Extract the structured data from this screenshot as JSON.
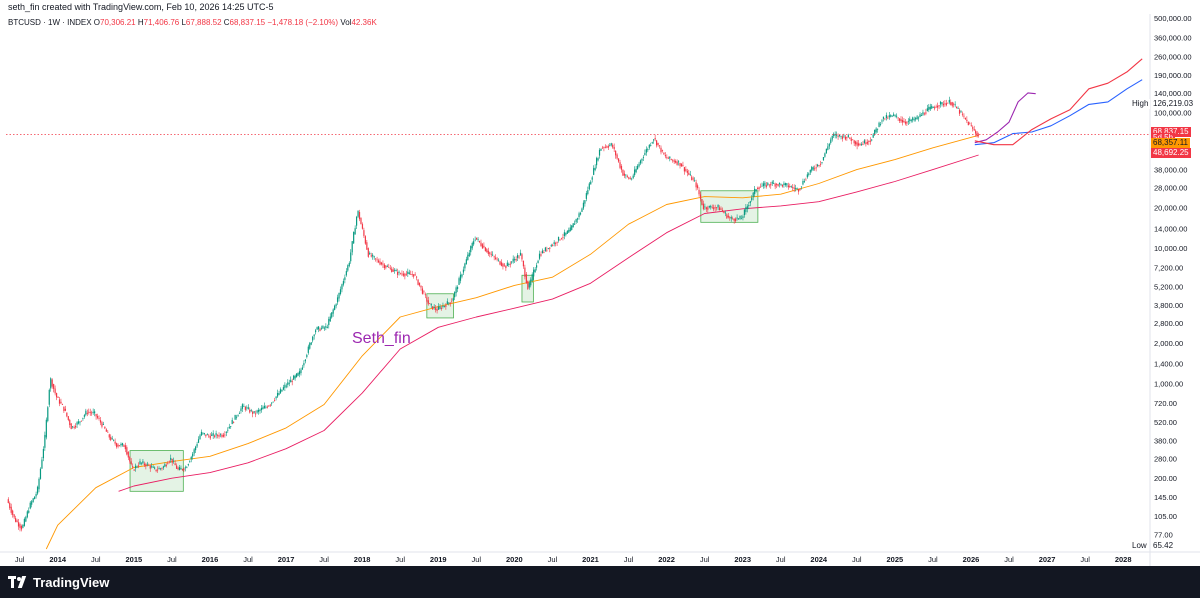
{
  "header": {
    "caption": "seth_fin created with TradingView.com, Feb 10, 2026 14:25 UTC-5"
  },
  "legend": {
    "symbol": "BTCUSD · 1W · INDEX",
    "open_label": "O",
    "open": "70,306.21",
    "high_label": "H",
    "high": "71,406.76",
    "low_label": "L",
    "low": "67,888.52",
    "close_label": "C",
    "close": "68,837.15",
    "change": "−1,478.18 (−2.10%)",
    "vol_label": "Vol",
    "vol": "42.36K"
  },
  "watermark": "Seth_fin",
  "footer": {
    "brand": "TradingView"
  },
  "colors": {
    "up": "#089981",
    "down": "#f23645",
    "ma_orange": "#ff9800",
    "ma_red": "#e91e63",
    "projection_purple": "#9c27b0",
    "projection_blue": "#2962ff",
    "projection_pink": "#f23645",
    "box_fill": "#4caf50",
    "watermark": "#9c27b0"
  },
  "chart_data": {
    "type": "line",
    "symbol": "BTCUSD",
    "interval": "1W",
    "y_scale": "log",
    "ylim": [
      60,
      500000
    ],
    "xlim": [
      "2013-06",
      "2028-04"
    ],
    "grid": false,
    "y_ticks": [
      "500,000.00",
      "360,000.00",
      "260,000.00",
      "190,000.00",
      "140,000.00",
      "100,000.00",
      "68,837.15",
      "50,000.00",
      "38,000.00",
      "28,000.00",
      "20,000.00",
      "14,000.00",
      "10,000.00",
      "7,200.00",
      "5,200.00",
      "3,800.00",
      "2,800.00",
      "2,000.00",
      "1,400.00",
      "1,000.00",
      "720.00",
      "520.00",
      "380.00",
      "280.00",
      "200.00",
      "145.00",
      "105.00",
      "77.00",
      "65.42"
    ],
    "y_tick_values": [
      500000,
      360000,
      260000,
      190000,
      140000,
      100000,
      68837,
      50000,
      38000,
      28000,
      20000,
      14000,
      10000,
      7200,
      5200,
      3800,
      2800,
      2000,
      1400,
      1000,
      720,
      520,
      380,
      280,
      200,
      145,
      105,
      77
    ],
    "x_ticks": [
      {
        "label": "Jul",
        "t": 2013.5
      },
      {
        "label": "2014",
        "t": 2014.0
      },
      {
        "label": "Jul",
        "t": 2014.5
      },
      {
        "label": "2015",
        "t": 2015.0
      },
      {
        "label": "Jul",
        "t": 2015.5
      },
      {
        "label": "2016",
        "t": 2016.0
      },
      {
        "label": "Jul",
        "t": 2016.5
      },
      {
        "label": "2017",
        "t": 2017.0
      },
      {
        "label": "Jul",
        "t": 2017.5
      },
      {
        "label": "2018",
        "t": 2018.0
      },
      {
        "label": "Jul",
        "t": 2018.5
      },
      {
        "label": "2019",
        "t": 2019.0
      },
      {
        "label": "Jul",
        "t": 2019.5
      },
      {
        "label": "2020",
        "t": 2020.0
      },
      {
        "label": "Jul",
        "t": 2020.5
      },
      {
        "label": "2021",
        "t": 2021.0
      },
      {
        "label": "Jul",
        "t": 2021.5
      },
      {
        "label": "2022",
        "t": 2022.0
      },
      {
        "label": "Jul",
        "t": 2022.5
      },
      {
        "label": "2023",
        "t": 2023.0
      },
      {
        "label": "Jul",
        "t": 2023.5
      },
      {
        "label": "2024",
        "t": 2024.0
      },
      {
        "label": "Jul",
        "t": 2024.5
      },
      {
        "label": "2025",
        "t": 2025.0
      },
      {
        "label": "Jul",
        "t": 2025.5
      },
      {
        "label": "2026",
        "t": 2026.0
      },
      {
        "label": "Jul",
        "t": 2026.5
      },
      {
        "label": "2027",
        "t": 2027.0
      },
      {
        "label": "Jul",
        "t": 2027.5
      },
      {
        "label": "2028",
        "t": 2028.0
      }
    ],
    "price_path": [
      [
        2013.35,
        140
      ],
      [
        2013.45,
        100
      ],
      [
        2013.55,
        85
      ],
      [
        2013.65,
        125
      ],
      [
        2013.75,
        160
      ],
      [
        2013.85,
        400
      ],
      [
        2013.92,
        1100
      ],
      [
        2014.0,
        800
      ],
      [
        2014.1,
        650
      ],
      [
        2014.2,
        470
      ],
      [
        2014.3,
        520
      ],
      [
        2014.4,
        620
      ],
      [
        2014.5,
        600
      ],
      [
        2014.6,
        500
      ],
      [
        2014.7,
        400
      ],
      [
        2014.8,
        350
      ],
      [
        2014.9,
        350
      ],
      [
        2015.0,
        230
      ],
      [
        2015.1,
        260
      ],
      [
        2015.2,
        250
      ],
      [
        2015.3,
        230
      ],
      [
        2015.4,
        240
      ],
      [
        2015.5,
        280
      ],
      [
        2015.6,
        230
      ],
      [
        2015.7,
        240
      ],
      [
        2015.8,
        310
      ],
      [
        2015.9,
        430
      ],
      [
        2016.0,
        410
      ],
      [
        2016.2,
        420
      ],
      [
        2016.45,
        680
      ],
      [
        2016.6,
        600
      ],
      [
        2016.8,
        700
      ],
      [
        2017.0,
        950
      ],
      [
        2017.2,
        1200
      ],
      [
        2017.4,
        2500
      ],
      [
        2017.55,
        2600
      ],
      [
        2017.7,
        4300
      ],
      [
        2017.85,
        8000
      ],
      [
        2017.96,
        19000
      ],
      [
        2018.1,
        9000
      ],
      [
        2018.3,
        7500
      ],
      [
        2018.5,
        6500
      ],
      [
        2018.7,
        6400
      ],
      [
        2018.9,
        3800
      ],
      [
        2019.0,
        3500
      ],
      [
        2019.2,
        4100
      ],
      [
        2019.4,
        8500
      ],
      [
        2019.5,
        12000
      ],
      [
        2019.7,
        9000
      ],
      [
        2019.9,
        7300
      ],
      [
        2020.1,
        9000
      ],
      [
        2020.2,
        5000
      ],
      [
        2020.35,
        9000
      ],
      [
        2020.55,
        11000
      ],
      [
        2020.75,
        13500
      ],
      [
        2020.9,
        19000
      ],
      [
        2021.0,
        29000
      ],
      [
        2021.15,
        55000
      ],
      [
        2021.3,
        58000
      ],
      [
        2021.45,
        35000
      ],
      [
        2021.55,
        32000
      ],
      [
        2021.7,
        47000
      ],
      [
        2021.85,
        65000
      ],
      [
        2022.0,
        47000
      ],
      [
        2022.2,
        42000
      ],
      [
        2022.4,
        30000
      ],
      [
        2022.5,
        20000
      ],
      [
        2022.7,
        20000
      ],
      [
        2022.85,
        16500
      ],
      [
        2023.0,
        16500
      ],
      [
        2023.2,
        28000
      ],
      [
        2023.4,
        30000
      ],
      [
        2023.6,
        29000
      ],
      [
        2023.75,
        27000
      ],
      [
        2023.9,
        37000
      ],
      [
        2024.05,
        43000
      ],
      [
        2024.2,
        68000
      ],
      [
        2024.4,
        66000
      ],
      [
        2024.55,
        58000
      ],
      [
        2024.7,
        63000
      ],
      [
        2024.85,
        90000
      ],
      [
        2025.0,
        95000
      ],
      [
        2025.15,
        85000
      ],
      [
        2025.3,
        90000
      ],
      [
        2025.45,
        105000
      ],
      [
        2025.6,
        115000
      ],
      [
        2025.75,
        120000
      ],
      [
        2025.85,
        105000
      ],
      [
        2025.95,
        88000
      ],
      [
        2026.1,
        69000
      ]
    ],
    "series": [
      {
        "name": "",
        "color": "#ff9800",
        "values": [
          [
            2013.85,
            60
          ],
          [
            2014.0,
            90
          ],
          [
            2014.5,
            170
          ],
          [
            2015.0,
            240
          ],
          [
            2015.5,
            265
          ],
          [
            2016.0,
            290
          ],
          [
            2016.5,
            360
          ],
          [
            2017.0,
            470
          ],
          [
            2017.5,
            700
          ],
          [
            2018.0,
            1600
          ],
          [
            2018.5,
            3100
          ],
          [
            2019.0,
            3700
          ],
          [
            2019.5,
            4300
          ],
          [
            2020.0,
            5300
          ],
          [
            2020.5,
            6100
          ],
          [
            2021.0,
            9000
          ],
          [
            2021.5,
            15000
          ],
          [
            2022.0,
            21000
          ],
          [
            2022.5,
            24000
          ],
          [
            2023.0,
            23500
          ],
          [
            2023.5,
            25000
          ],
          [
            2024.0,
            30000
          ],
          [
            2024.5,
            38000
          ],
          [
            2025.0,
            45000
          ],
          [
            2025.5,
            55000
          ],
          [
            2026.1,
            68000
          ]
        ]
      },
      {
        "name": "",
        "color": "#e91e63",
        "values": [
          [
            2014.8,
            160
          ],
          [
            2015.0,
            175
          ],
          [
            2015.5,
            200
          ],
          [
            2016.0,
            220
          ],
          [
            2016.5,
            260
          ],
          [
            2017.0,
            330
          ],
          [
            2017.5,
            450
          ],
          [
            2018.0,
            850
          ],
          [
            2018.5,
            1800
          ],
          [
            2019.0,
            2600
          ],
          [
            2019.5,
            3100
          ],
          [
            2020.0,
            3600
          ],
          [
            2020.5,
            4200
          ],
          [
            2021.0,
            5500
          ],
          [
            2021.5,
            8500
          ],
          [
            2022.0,
            13000
          ],
          [
            2022.5,
            18000
          ],
          [
            2023.0,
            19500
          ],
          [
            2023.5,
            20500
          ],
          [
            2024.0,
            22000
          ],
          [
            2024.5,
            26000
          ],
          [
            2025.0,
            31000
          ],
          [
            2025.5,
            38000
          ],
          [
            2026.1,
            48692
          ]
        ]
      },
      {
        "name": "",
        "color": "#9c27b0",
        "values": [
          [
            2026.05,
            60000
          ],
          [
            2026.2,
            63000
          ],
          [
            2026.35,
            72000
          ],
          [
            2026.5,
            85000
          ],
          [
            2026.62,
            120000
          ],
          [
            2026.75,
            140000
          ],
          [
            2026.85,
            138000
          ]
        ]
      },
      {
        "name": "",
        "color": "#2962ff",
        "values": [
          [
            2026.05,
            58000
          ],
          [
            2026.3,
            60000
          ],
          [
            2026.55,
            70000
          ],
          [
            2026.8,
            72000
          ],
          [
            2027.05,
            80000
          ],
          [
            2027.3,
            95000
          ],
          [
            2027.55,
            115000
          ],
          [
            2027.8,
            120000
          ],
          [
            2028.05,
            150000
          ],
          [
            2028.25,
            175000
          ]
        ]
      },
      {
        "name": "",
        "color": "#f23645",
        "values": [
          [
            2026.05,
            62000
          ],
          [
            2026.3,
            58000
          ],
          [
            2026.55,
            58000
          ],
          [
            2026.8,
            75000
          ],
          [
            2027.05,
            90000
          ],
          [
            2027.3,
            105000
          ],
          [
            2027.55,
            150000
          ],
          [
            2027.8,
            165000
          ],
          [
            2028.05,
            200000
          ],
          [
            2028.25,
            250000
          ]
        ]
      }
    ],
    "boxes": [
      {
        "t0": 2014.95,
        "t1": 2015.65,
        "p_low": 160,
        "p_high": 320
      },
      {
        "t0": 2018.85,
        "t1": 2019.2,
        "p_low": 3050,
        "p_high": 4600
      },
      {
        "t0": 2020.1,
        "t1": 2020.25,
        "p_low": 4000,
        "p_high": 6300
      },
      {
        "t0": 2022.45,
        "t1": 2023.2,
        "p_low": 15500,
        "p_high": 26500
      }
    ],
    "price_labels": [
      {
        "text": "High",
        "value": "126,219.03",
        "price": 115000,
        "bg": "#ffffff",
        "fg": "#131722"
      },
      {
        "text": "",
        "value": "68,837.15",
        "price": 72000,
        "bg": "#f23645",
        "fg": "#ffffff"
      },
      {
        "text": "",
        "value": "5d 5h",
        "price": 65000,
        "bg": "#f23645",
        "fg": "#ffffff"
      },
      {
        "text": "",
        "value": "68,357.11",
        "price": 59500,
        "bg": "#ff9800",
        "fg": "#131722"
      },
      {
        "text": "",
        "value": "48,692.25",
        "price": 50500,
        "bg": "#f23645",
        "fg": "#ffffff"
      },
      {
        "text": "Low",
        "value": "65.42",
        "price": 63,
        "bg": "#ffffff",
        "fg": "#131722"
      }
    ],
    "current_price": 68837.15
  }
}
